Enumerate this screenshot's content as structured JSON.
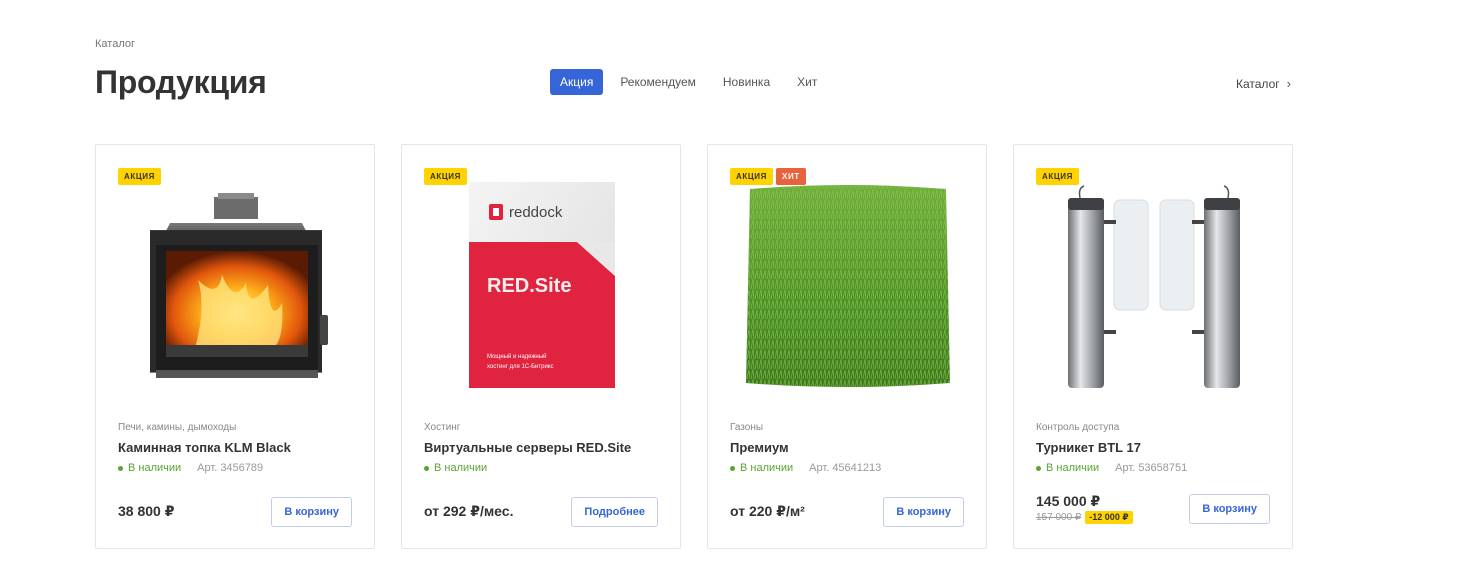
{
  "breadcrumb": "Каталог",
  "title": "Продукция",
  "tabs": [
    {
      "label": "Акция",
      "active": true
    },
    {
      "label": "Рекомендуем",
      "active": false
    },
    {
      "label": "Новинка",
      "active": false
    },
    {
      "label": "Хит",
      "active": false
    }
  ],
  "catalog_link": "Каталог",
  "colors": {
    "accent": "#3665d8",
    "sale_badge": "#ffd200",
    "hit_badge": "#e8623b",
    "in_stock": "#5aa531"
  },
  "products": [
    {
      "badges": [
        "Акция"
      ],
      "image": "fireplace-image",
      "category": "Печи, камины, дымоходы",
      "name": "Каминная топка KLM Black",
      "stock": "В наличии",
      "article": "Арт. 3456789",
      "price": "38 800 ₽",
      "button": "В корзину"
    },
    {
      "badges": [
        "Акция"
      ],
      "image": "red-site-box-image",
      "image_text": {
        "brand": "reddock",
        "product": "RED.Site",
        "desc1": "Мощный и надежный",
        "desc2": "хостинг для 1С-Битрикс"
      },
      "category": "Хостинг",
      "name": "Виртуальные серверы RED.Site",
      "stock": "В наличии",
      "article": "",
      "price": "от 292 ₽/мес.",
      "button": "Подробнее"
    },
    {
      "badges": [
        "Акция",
        "Хит"
      ],
      "image": "grass-image",
      "category": "Газоны",
      "name": "Премиум",
      "stock": "В наличии",
      "article": "Арт. 45641213",
      "price": "от 220 ₽/м²",
      "button": "В корзину"
    },
    {
      "badges": [
        "Акция"
      ],
      "image": "turnstile-image",
      "category": "Контроль доступа",
      "name": "Турникет BTL 17",
      "stock": "В наличии",
      "article": "Арт. 53658751",
      "price": "145 000 ₽",
      "old_price": "157 000 ₽",
      "discount": "-12 000 ₽",
      "button": "В корзину"
    }
  ]
}
